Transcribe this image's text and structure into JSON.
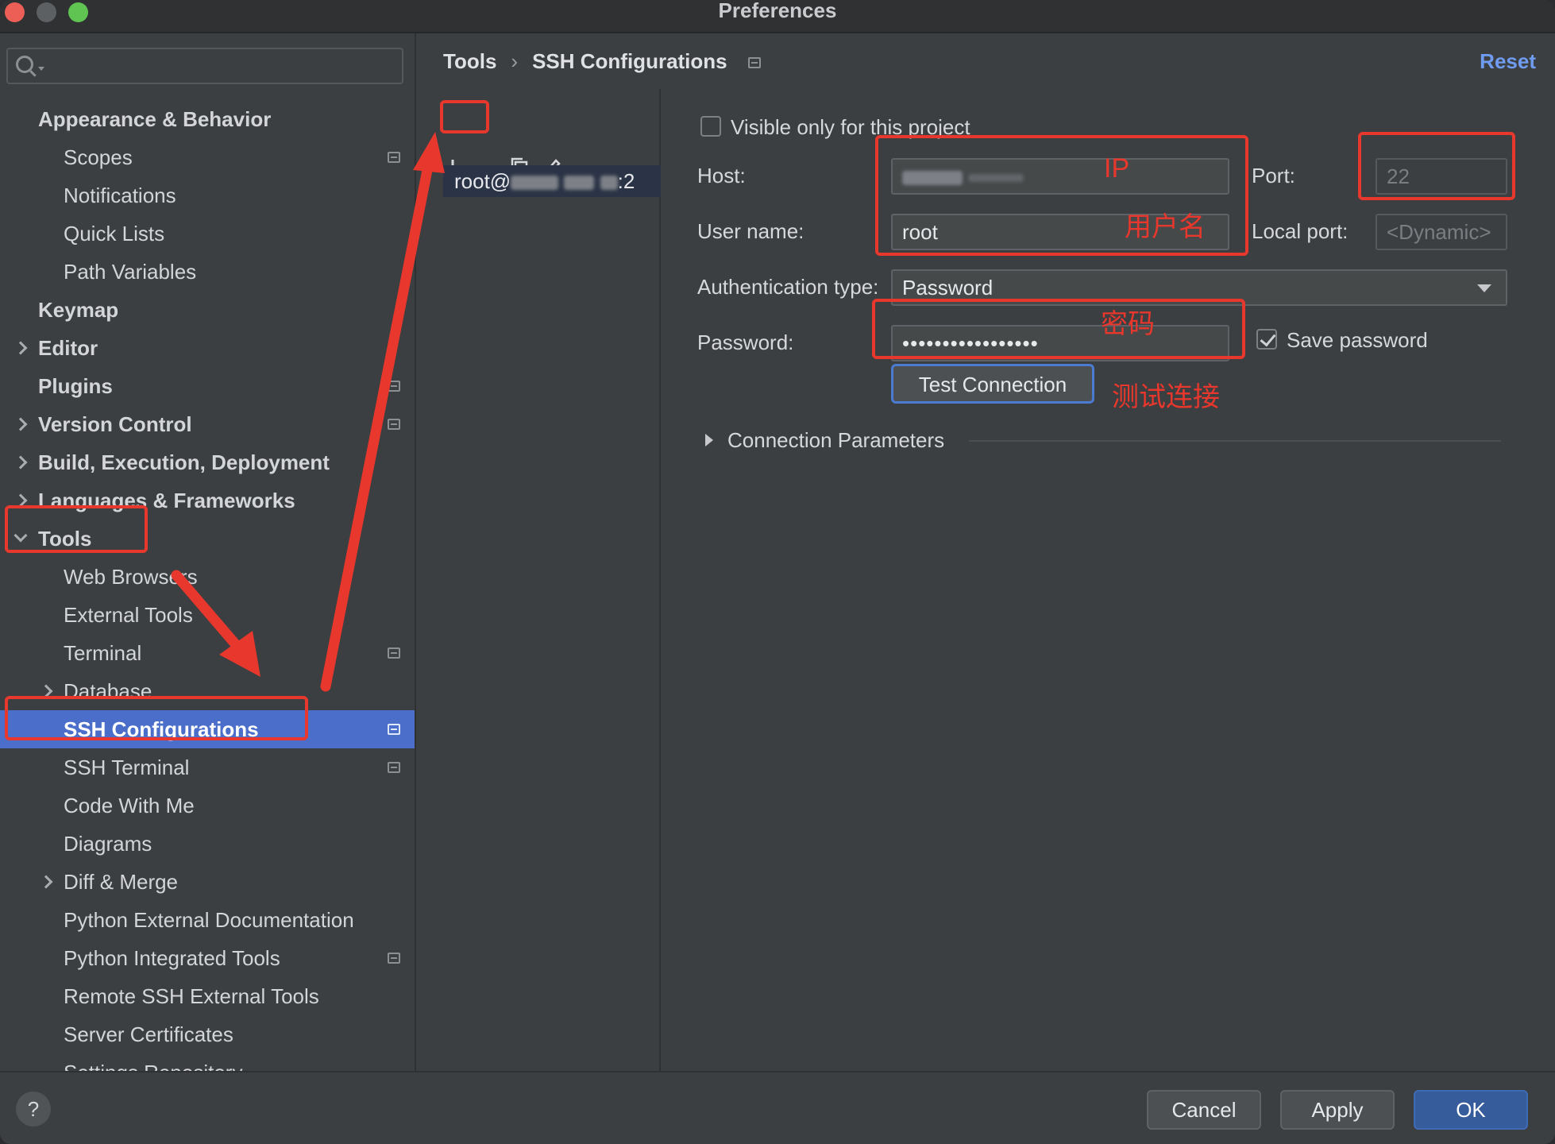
{
  "window": {
    "title": "Preferences"
  },
  "sidebar": {
    "search_placeholder": "",
    "items": [
      {
        "label": "Appearance & Behavior",
        "level": 0,
        "bold": true,
        "chevron": "none"
      },
      {
        "label": "Scopes",
        "level": 1,
        "icon": true
      },
      {
        "label": "Notifications",
        "level": 1
      },
      {
        "label": "Quick Lists",
        "level": 1
      },
      {
        "label": "Path Variables",
        "level": 1
      },
      {
        "label": "Keymap",
        "level": 0,
        "bold": true
      },
      {
        "label": "Editor",
        "level": 0,
        "bold": true,
        "chevron": "right"
      },
      {
        "label": "Plugins",
        "level": 0,
        "bold": true,
        "icon": true
      },
      {
        "label": "Version Control",
        "level": 0,
        "bold": true,
        "chevron": "right",
        "icon": true
      },
      {
        "label": "Build, Execution, Deployment",
        "level": 0,
        "bold": true,
        "chevron": "right"
      },
      {
        "label": "Languages & Frameworks",
        "level": 0,
        "bold": true,
        "chevron": "right"
      },
      {
        "label": "Tools",
        "level": 0,
        "bold": true,
        "chevron": "down"
      },
      {
        "label": "Web Browsers",
        "level": 1
      },
      {
        "label": "External Tools",
        "level": 1
      },
      {
        "label": "Terminal",
        "level": 1,
        "icon": true
      },
      {
        "label": "Database",
        "level": 1,
        "chevron": "right"
      },
      {
        "label": "SSH Configurations",
        "level": 1,
        "selected": true,
        "icon": true
      },
      {
        "label": "SSH Terminal",
        "level": 1,
        "icon": true
      },
      {
        "label": "Code With Me",
        "level": 1
      },
      {
        "label": "Diagrams",
        "level": 1
      },
      {
        "label": "Diff & Merge",
        "level": 1,
        "chevron": "right"
      },
      {
        "label": "Python External Documentation",
        "level": 1
      },
      {
        "label": "Python Integrated Tools",
        "level": 1,
        "icon": true
      },
      {
        "label": "Remote SSH External Tools",
        "level": 1
      },
      {
        "label": "Server Certificates",
        "level": 1
      },
      {
        "label": "Settings Repository",
        "level": 1
      }
    ]
  },
  "breadcrumb": {
    "parent": "Tools",
    "current": "SSH Configurations",
    "separator": "›"
  },
  "reset_label": "Reset",
  "toolbar": {
    "add": "+",
    "remove": "−"
  },
  "connection_list": {
    "item_prefix": "root@",
    "item_suffix": ":2"
  },
  "form": {
    "visible_only_label": "Visible only for this project",
    "host_label": "Host:",
    "port_label": "Port:",
    "port_value": "22",
    "username_label": "User name:",
    "username_value": "root",
    "local_port_label": "Local port:",
    "local_port_value": "<Dynamic>",
    "auth_type_label": "Authentication type:",
    "auth_type_value": "Password",
    "password_label": "Password:",
    "password_value": "•••••••••••••••••",
    "save_password_label": "Save password",
    "test_connection_label": "Test Connection",
    "connection_parameters_label": "Connection Parameters"
  },
  "annotations": {
    "ip": "IP",
    "username": "用户名",
    "password": "密码",
    "test": "测试连接",
    "color": "#e8372c"
  },
  "footer": {
    "help": "?",
    "cancel": "Cancel",
    "apply": "Apply",
    "ok": "OK"
  },
  "colors": {
    "background": "#3c3f41",
    "selection": "#4a6ec9",
    "link": "#6f9cf0",
    "primary_button": "#365c9c"
  }
}
